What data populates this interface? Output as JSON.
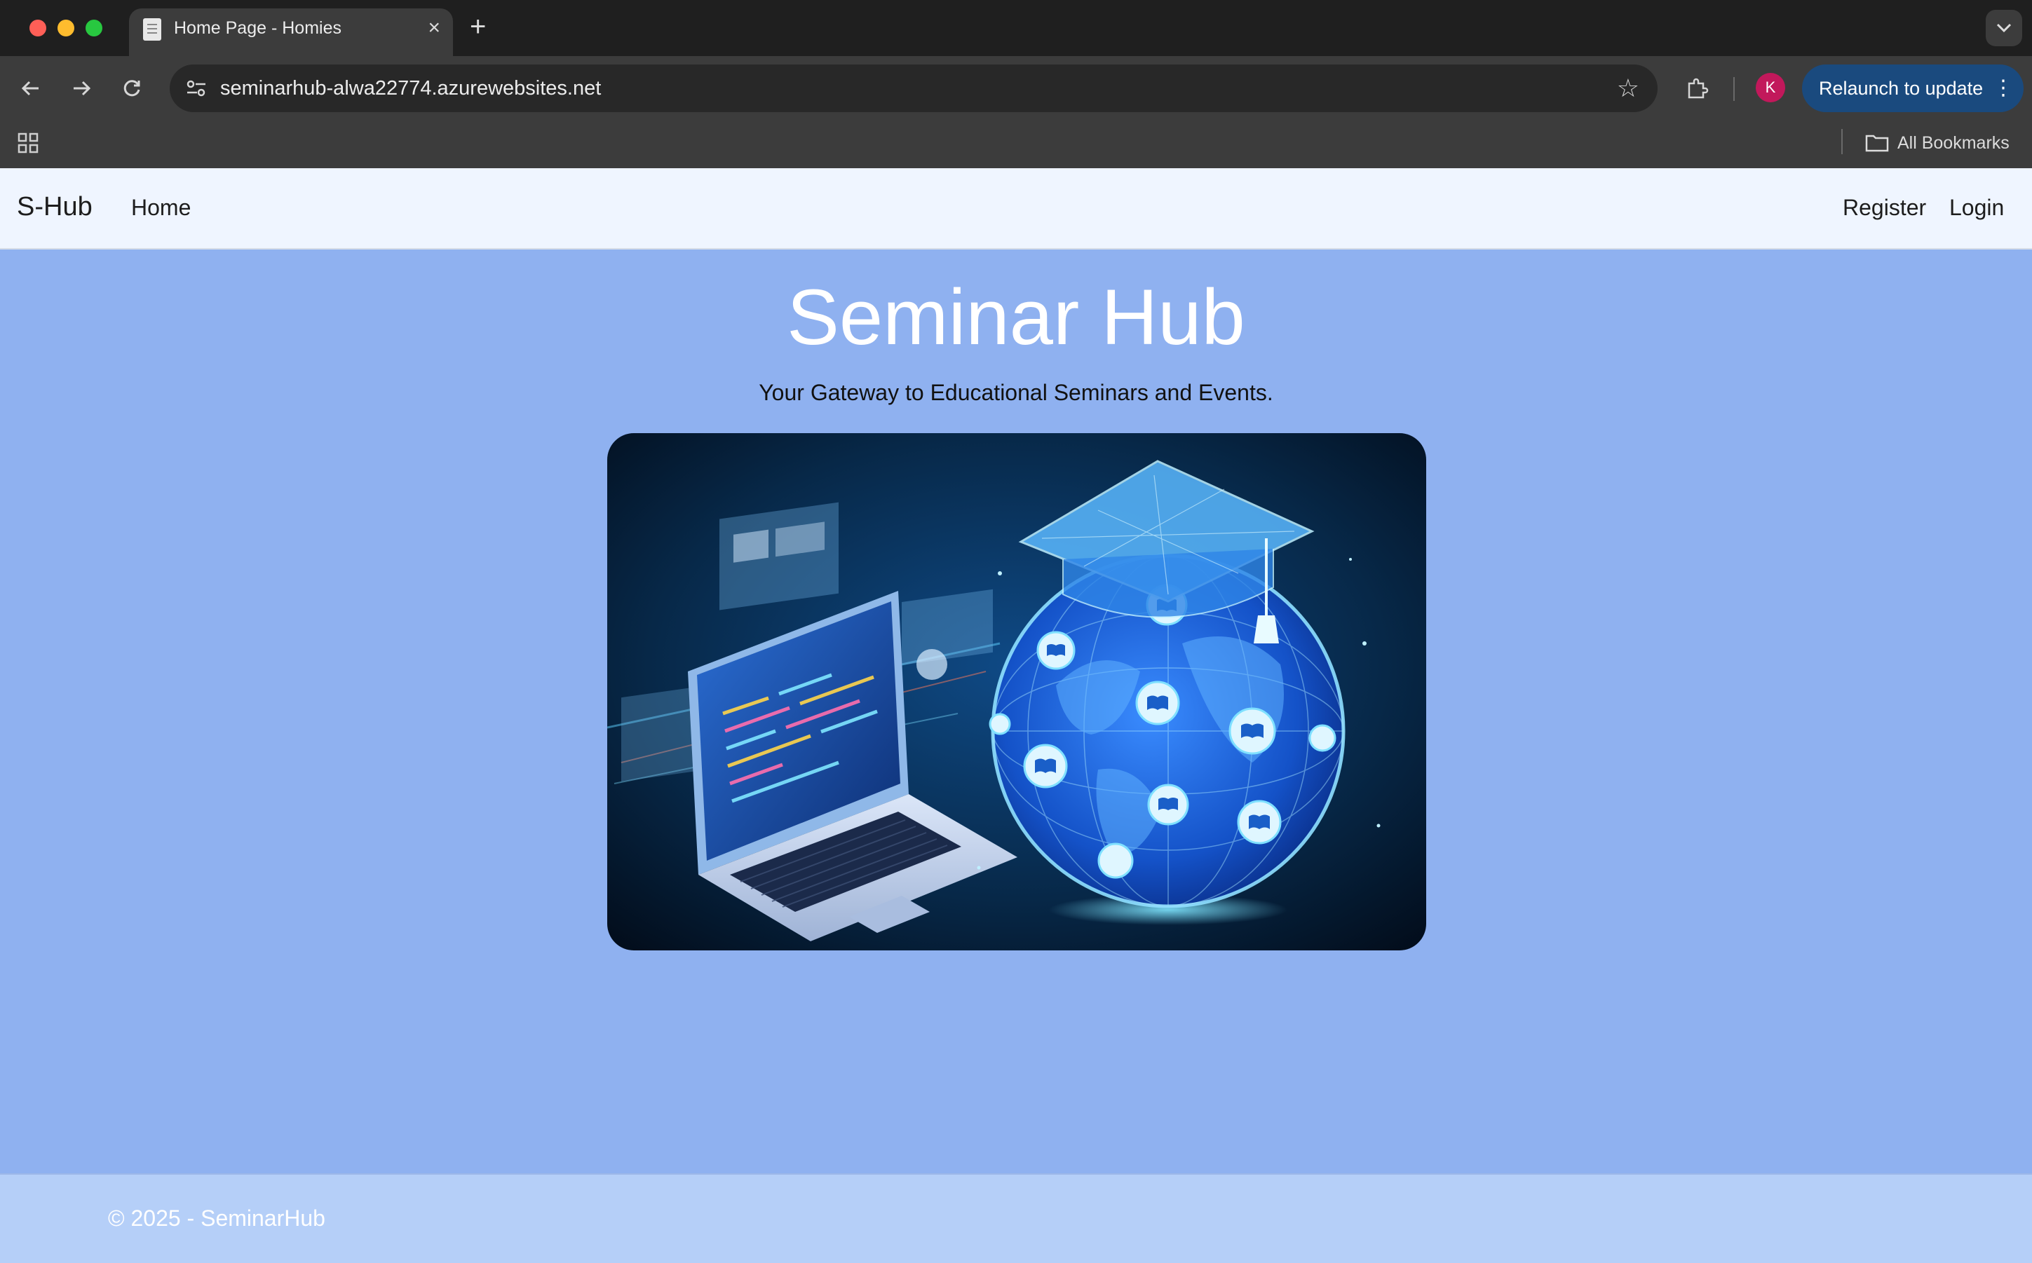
{
  "browser": {
    "tab_title": "Home Page - Homies",
    "tab_close": "×",
    "new_tab": "+",
    "url": "seminarhub-alwa22774.azurewebsites.net",
    "profile_initial": "K",
    "relaunch_label": "Relaunch to update",
    "all_bookmarks": "All Bookmarks",
    "icons": {
      "back": "back-arrow-icon",
      "forward": "forward-arrow-icon",
      "reload": "reload-icon",
      "site_info": "site-info-icon",
      "star": "star-icon",
      "extensions": "puzzle-icon",
      "apps": "apps-grid-icon",
      "folder": "folder-icon",
      "more": "kebab-menu-icon",
      "tab_search": "chevron-down-icon"
    }
  },
  "site": {
    "brand": "S-Hub",
    "nav_home": "Home",
    "nav_register": "Register",
    "nav_login": "Login",
    "hero_title": "Seminar Hub",
    "hero_subtitle": "Your Gateway to Educational Seminars and Events.",
    "footer": "© 2025 - SeminarHub"
  },
  "colors": {
    "page_bg": "#8fb1f0",
    "navbar_bg": "#eff5ff",
    "footer_bg": "#b5cff8",
    "chrome_bg": "#3c3c3c",
    "relaunch_bg": "#1a4a7e",
    "avatar_bg": "#c2185b"
  }
}
